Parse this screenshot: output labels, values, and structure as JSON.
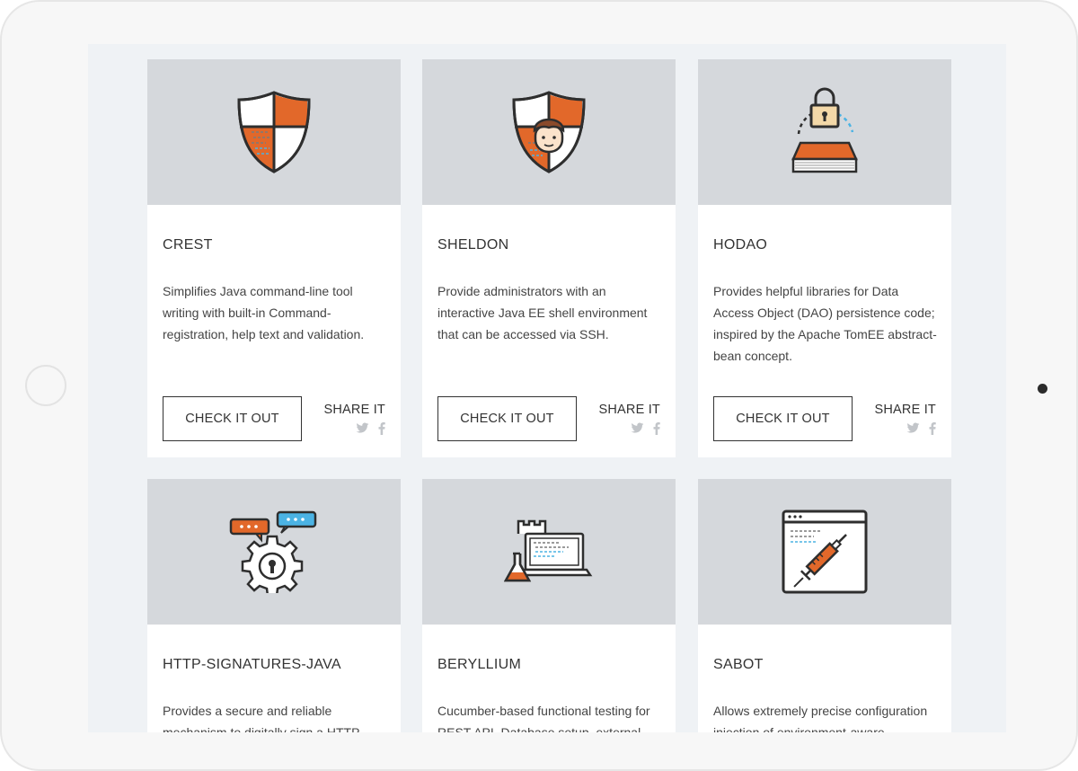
{
  "cta_label": "CHECK IT OUT",
  "share_label": "SHARE IT",
  "colors": {
    "accent_orange": "#e2682a",
    "accent_blue": "#4bb3e4",
    "card_hero_bg": "#d5d8dc",
    "screen_bg": "#eff2f5"
  },
  "cards": [
    {
      "title": "CREST",
      "description": "Simplifies Java command-line tool writing with built-in Command-registration, help text and validation.",
      "icon": "shield-icon"
    },
    {
      "title": "SHELDON",
      "description": "Provide administrators with an interactive Java EE shell environment that can be accessed via SSH.",
      "icon": "shield-user-icon"
    },
    {
      "title": "HODAO",
      "description": "Provides helpful libraries for Data Access Object (DAO) persistence code; inspired by the Apache TomEE abstract-bean concept.",
      "icon": "lock-book-icon"
    },
    {
      "title": "HTTP-SIGNATURES-JAVA",
      "description": "Provides a secure and reliable mechanism to digitally sign a HTTP",
      "icon": "gear-chat-icon"
    },
    {
      "title": "BERYLLIUM",
      "description": "Cucumber-based functional testing for REST API, Database setup, external",
      "icon": "laptop-flask-icon"
    },
    {
      "title": "SABOT",
      "description": "Allows extremely precise configuration injection of environment-aware",
      "icon": "syringe-window-icon"
    }
  ]
}
